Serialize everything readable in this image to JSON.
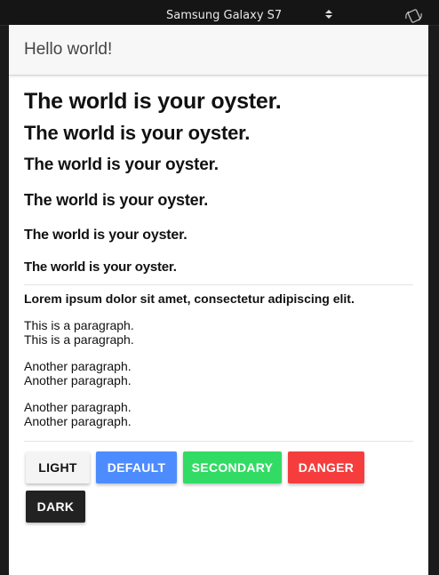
{
  "device_bar": {
    "device_name": "Samsung Galaxy S7",
    "rotate_icon": "rotate-device-icon"
  },
  "navbar": {
    "title": "Hello world!"
  },
  "headings": {
    "h1": "The world is your oyster.",
    "h2": "The world is your oyster.",
    "h3": "The world is your oyster.",
    "h4": "The world is your oyster.",
    "h5": "The world is your oyster.",
    "h6": "The world is your oyster."
  },
  "lead": "Lorem ipsum dolor sit amet, consectetur adipiscing elit.",
  "paragraphs": [
    {
      "line1": "This is a paragraph.",
      "line2": "This is a paragraph."
    },
    {
      "line1": "Another paragraph.",
      "line2": "Another paragraph."
    },
    {
      "line1": "Another paragraph.",
      "line2": "Another paragraph."
    }
  ],
  "buttons": {
    "light": "LIGHT",
    "default": "DEFAULT",
    "secondary": "SECONDARY",
    "danger": "DANGER",
    "dark": "DARK"
  },
  "colors": {
    "default": "#4d8cff",
    "secondary": "#32db64",
    "danger": "#f53d3d",
    "dark": "#222222",
    "light": "#f4f4f4"
  }
}
